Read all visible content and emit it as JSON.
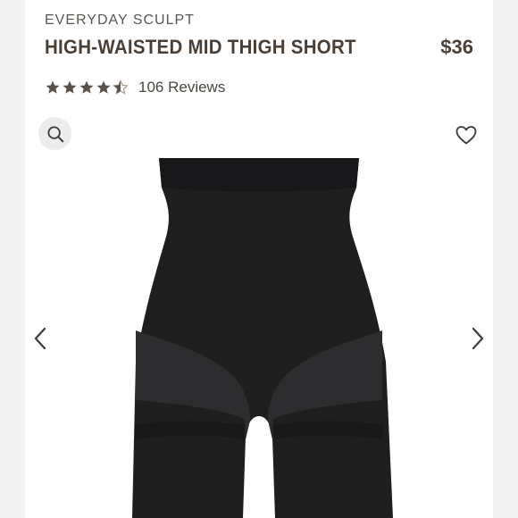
{
  "product": {
    "brand": "EVERYDAY SCULPT",
    "title": "HIGH-WAISTED MID THIGH SHORT",
    "price": "$36",
    "rating": 4.5,
    "rating_max": 5,
    "reviews_label": "106 Reviews",
    "image_alt": "Black high-waisted mid thigh shapewear short"
  },
  "icons": {
    "search": "search-icon",
    "wishlist": "heart-icon",
    "prev": "chevron-left-icon",
    "next": "chevron-right-icon",
    "star": "star-icon"
  },
  "colors": {
    "title_text": "#4a3f36",
    "star_fill": "#5b5048",
    "garment": "#1f1f20",
    "search_bg": "#ececec"
  }
}
